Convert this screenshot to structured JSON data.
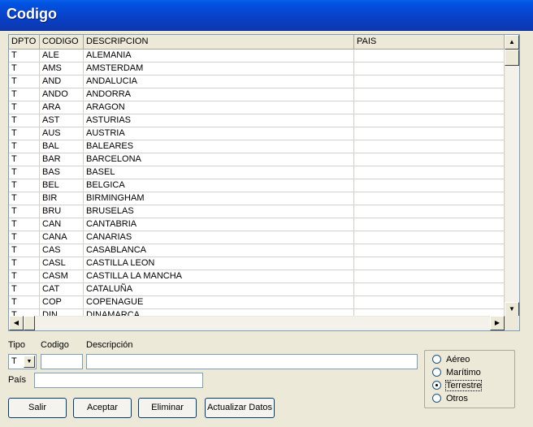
{
  "window": {
    "title": "Codigo"
  },
  "grid": {
    "columns": [
      "DPTO",
      "CODIGO",
      "DESCRIPCION",
      "PAIS"
    ],
    "rows": [
      [
        "T",
        "ALE",
        "ALEMANIA",
        ""
      ],
      [
        "T",
        "AMS",
        "AMSTERDAM",
        ""
      ],
      [
        "T",
        "AND",
        "ANDALUCIA",
        ""
      ],
      [
        "T",
        "ANDO",
        "ANDORRA",
        ""
      ],
      [
        "T",
        "ARA",
        "ARAGON",
        ""
      ],
      [
        "T",
        "AST",
        "ASTURIAS",
        ""
      ],
      [
        "T",
        "AUS",
        "AUSTRIA",
        ""
      ],
      [
        "T",
        "BAL",
        "BALEARES",
        ""
      ],
      [
        "T",
        "BAR",
        "BARCELONA",
        ""
      ],
      [
        "T",
        "BAS",
        "BASEL",
        ""
      ],
      [
        "T",
        "BEL",
        "BELGICA",
        ""
      ],
      [
        "T",
        "BIR",
        "BIRMINGHAM",
        ""
      ],
      [
        "T",
        "BRU",
        "BRUSELAS",
        ""
      ],
      [
        "T",
        "CAN",
        "CANTABRIA",
        ""
      ],
      [
        "T",
        "CANA",
        "CANARIAS",
        ""
      ],
      [
        "T",
        "CAS",
        "CASABLANCA",
        ""
      ],
      [
        "T",
        "CASL",
        "CASTILLA LEON",
        ""
      ],
      [
        "T",
        "CASM",
        "CASTILLA LA MANCHA",
        ""
      ],
      [
        "T",
        "CAT",
        "CATALUÑA",
        ""
      ],
      [
        "T",
        "COP",
        "COPENAGUE",
        ""
      ],
      [
        "T",
        "DIN",
        "DINAMARCA",
        ""
      ]
    ]
  },
  "form": {
    "tipo_label": "Tipo",
    "codigo_label": "Codigo",
    "descripcion_label": "Descripción",
    "pais_label": "País",
    "tipo_value": "T",
    "codigo_value": "",
    "descripcion_value": "",
    "pais_value": ""
  },
  "transport": {
    "options": [
      "Aéreo",
      "Marítimo",
      "Terrestre",
      "Otros"
    ],
    "selected": "Terrestre"
  },
  "buttons": {
    "salir": "Salir",
    "aceptar": "Aceptar",
    "eliminar": "Eliminar",
    "actualizar": "Actualizar Datos"
  }
}
